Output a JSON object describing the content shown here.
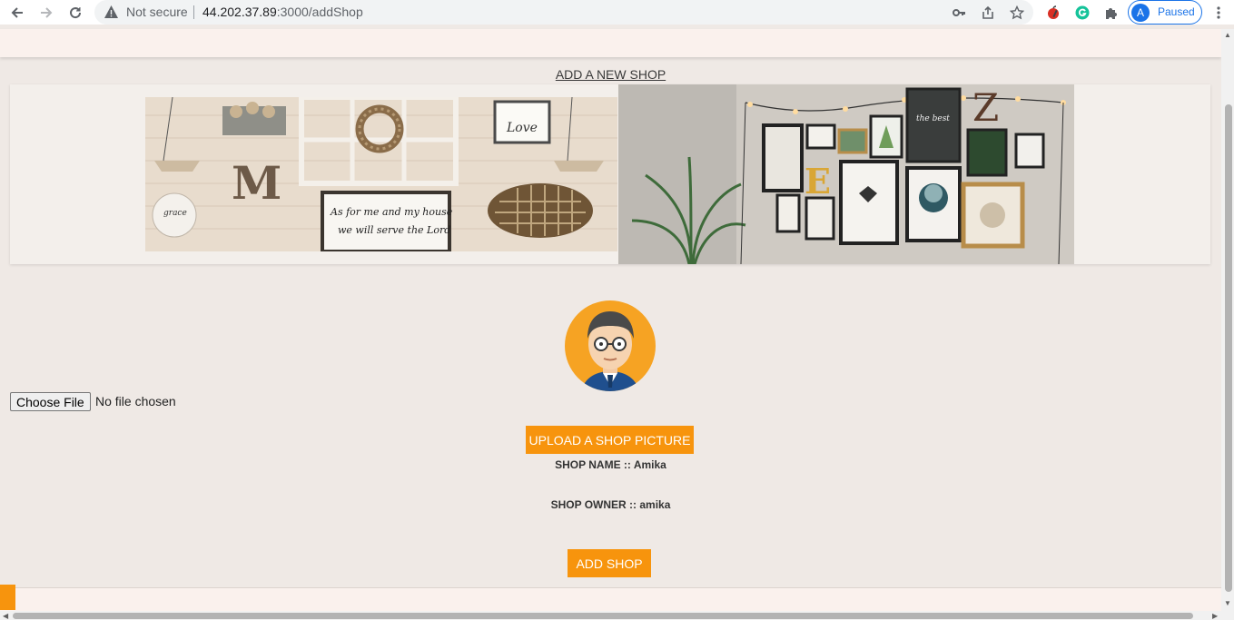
{
  "browser": {
    "security_label": "Not secure",
    "url_host": "44.202.37.89",
    "url_rest": ":3000/addShop",
    "profile_initial": "A",
    "profile_status": "Paused",
    "icons": [
      "back-icon",
      "forward-icon",
      "reload-icon",
      "warning-icon",
      "key-icon",
      "share-icon",
      "star-icon",
      "extension-apple-icon",
      "grammarly-icon",
      "puzzle-icon",
      "menu-dots-icon"
    ]
  },
  "page": {
    "heading": "ADD A NEW SHOP",
    "file_input": {
      "button_label": "Choose File",
      "status": "No file chosen"
    },
    "upload_button": "UPLOAD A SHOP PICTURE",
    "shop_name": "SHOP NAME :: Amika",
    "shop_owner": "SHOP OWNER :: amika",
    "add_button": "ADD SHOP"
  },
  "colors": {
    "accent": "#f7940d",
    "page_bg": "#efe9e5",
    "bar_bg": "#faf1ed",
    "profile_blue": "#1a73e8"
  }
}
